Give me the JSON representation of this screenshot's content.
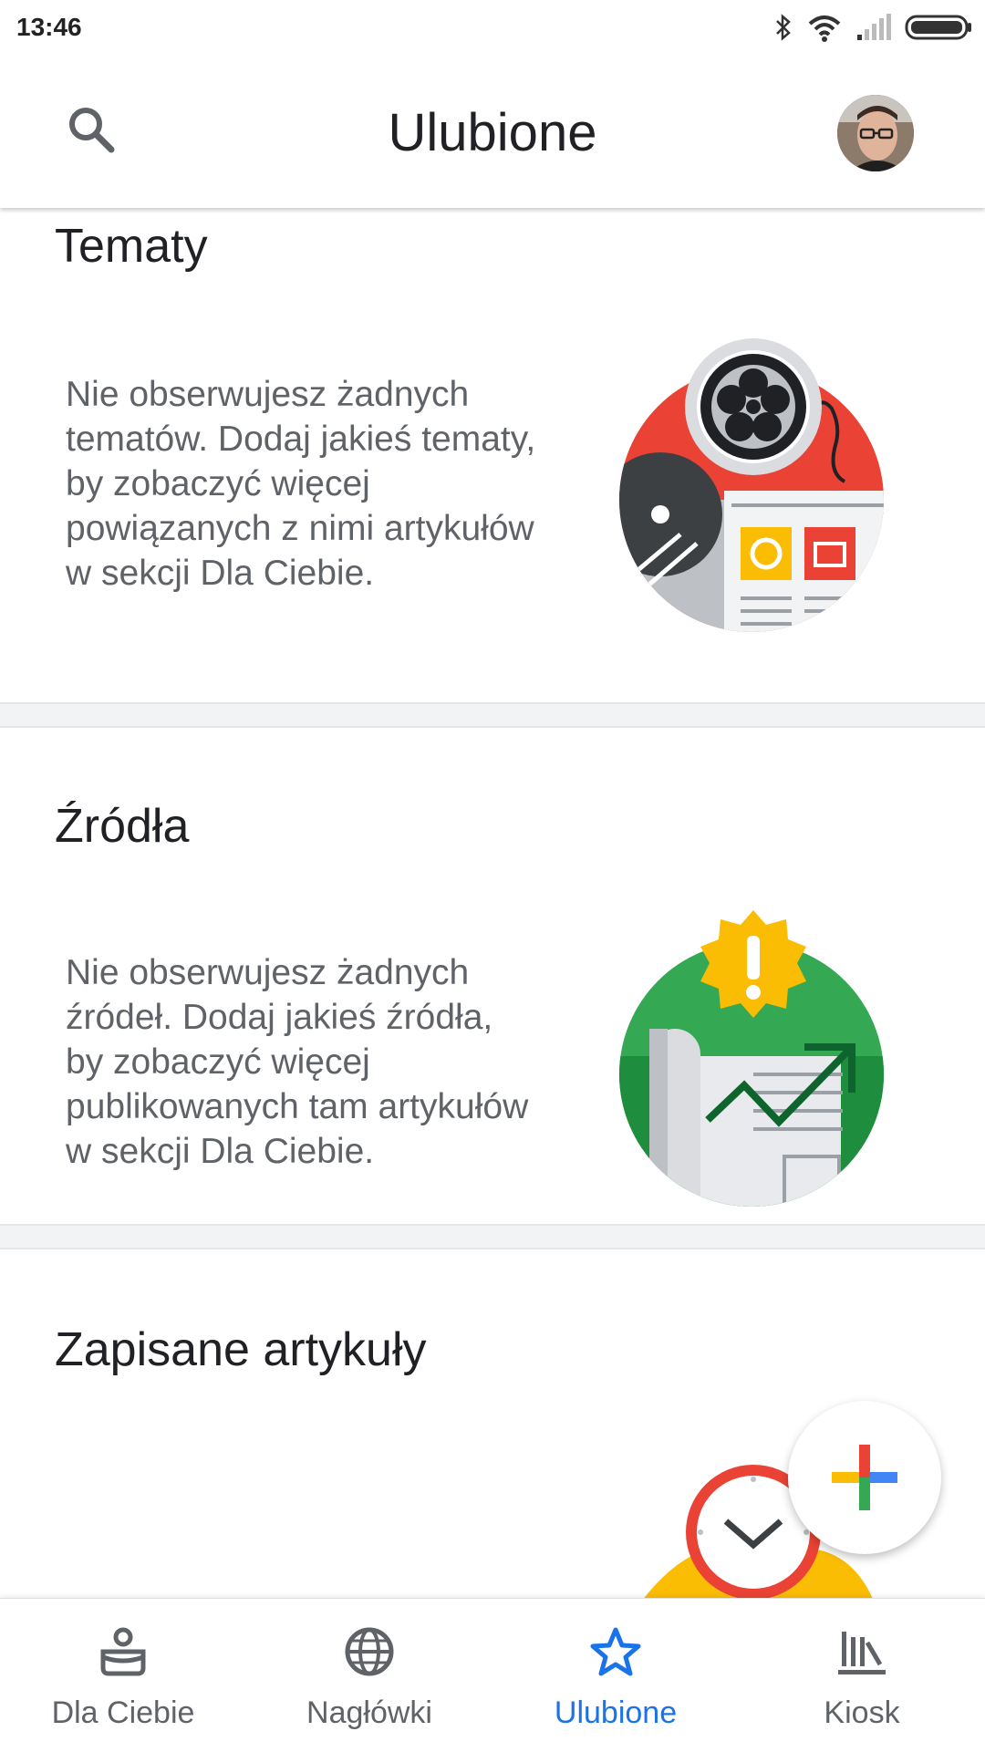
{
  "status_bar": {
    "time": "13:46",
    "icons": [
      "bluetooth-icon",
      "wifi-icon",
      "signal-icon",
      "battery-icon"
    ]
  },
  "app_bar": {
    "title": "Ulubione",
    "search_icon": "search-icon",
    "avatar": "user-avatar"
  },
  "sections": [
    {
      "heading": "Tematy",
      "description": "Nie obserwujesz żadnych tematów. Dodaj jakieś tematy, by zobaczyć więcej powiązanych z nimi artykułów w sekcji Dla Ciebie.",
      "illustration": "topics-illustration"
    },
    {
      "heading": "Źródła",
      "description": "Nie obserwujesz żadnych źródeł. Dodaj jakieś źródła, by zobaczyć więcej publikowanych tam artykułów w sekcji Dla Ciebie.",
      "illustration": "sources-illustration"
    },
    {
      "heading": "Zapisane artykuły",
      "illustration": "saved-articles-illustration"
    }
  ],
  "fab": {
    "icon": "plus-icon"
  },
  "bottom_nav": {
    "items": [
      {
        "label": "Dla Ciebie",
        "icon": "for-you-icon",
        "active": false
      },
      {
        "label": "Nagłówki",
        "icon": "globe-icon",
        "active": false
      },
      {
        "label": "Ulubione",
        "icon": "star-icon",
        "active": true
      },
      {
        "label": "Kiosk",
        "icon": "newsstand-icon",
        "active": false
      }
    ]
  },
  "colors": {
    "accent": "#1a73e8",
    "red": "#ea4335",
    "yellow": "#fbbc04",
    "green": "#34a853",
    "blue": "#4285f4"
  }
}
